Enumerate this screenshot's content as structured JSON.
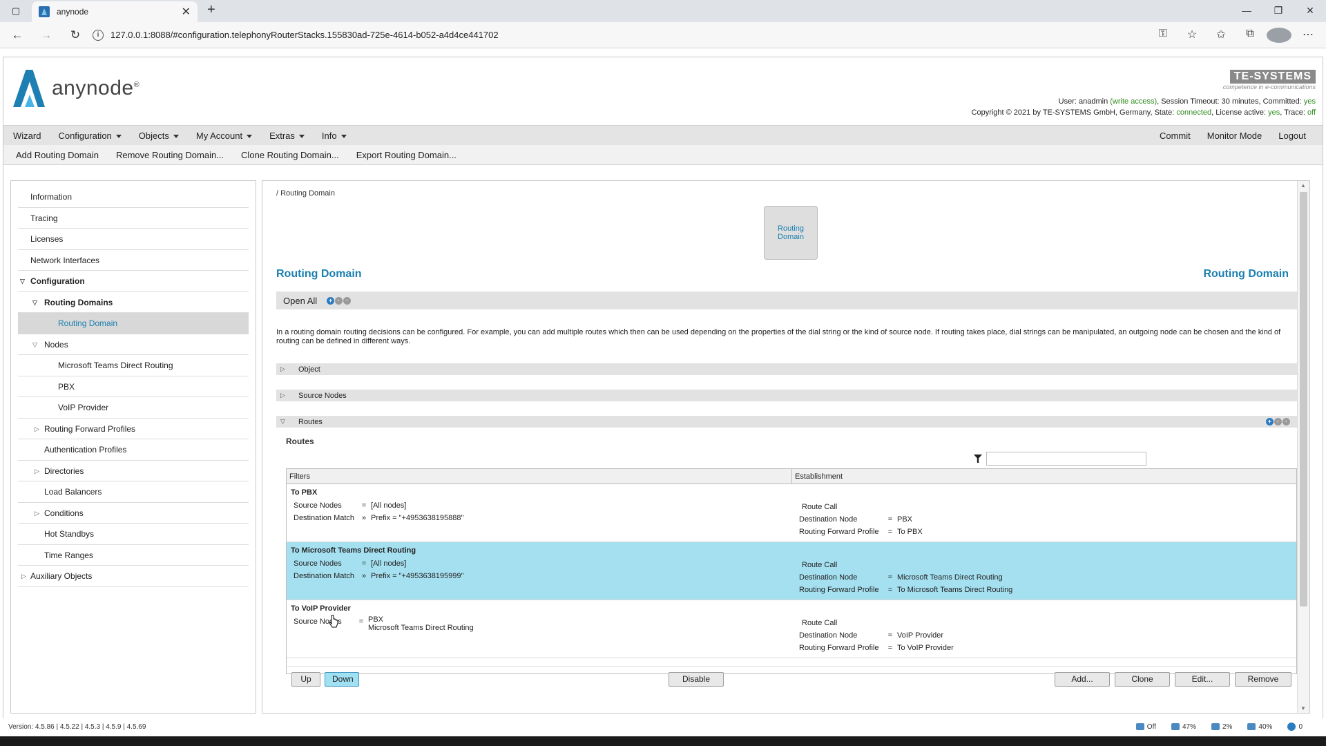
{
  "browser": {
    "tab_title": "anynode",
    "url": "127.0.0.1:8088/#configuration.telephonyRouterStacks.155830ad-725e-4614-b052-a4d4ce441702"
  },
  "header": {
    "brand": "anynode",
    "te_brand": "TE-SYSTEMS",
    "te_tagline": "competence in e-communications",
    "status": {
      "user_label": "User:",
      "user": "anadmin",
      "access": "(write access)",
      "session": ", Session Timeout: 30 minutes, Committed:",
      "committed": "yes",
      "copyright": "Copyright © 2021 by TE-SYSTEMS GmbH, Germany, State:",
      "state": "connected",
      "license_label": ", License active:",
      "license": "yes",
      "trace_label": ", Trace:",
      "trace": "off"
    }
  },
  "menu": {
    "wizard": "Wizard",
    "configuration": "Configuration",
    "objects": "Objects",
    "my_account": "My Account",
    "extras": "Extras",
    "info": "Info",
    "commit": "Commit",
    "monitor_mode": "Monitor Mode",
    "logout": "Logout"
  },
  "actions": {
    "add": "Add Routing Domain",
    "remove": "Remove Routing Domain...",
    "clone": "Clone Routing Domain...",
    "export": "Export Routing Domain..."
  },
  "sidebar": {
    "information": "Information",
    "tracing": "Tracing",
    "licenses": "Licenses",
    "network_interfaces": "Network Interfaces",
    "configuration": "Configuration",
    "routing_domains": "Routing Domains",
    "routing_domain": "Routing Domain",
    "nodes": "Nodes",
    "node_teams": "Microsoft Teams Direct Routing",
    "node_pbx": "PBX",
    "node_voip": "VoIP Provider",
    "routing_forward_profiles": "Routing Forward Profiles",
    "authentication_profiles": "Authentication Profiles",
    "directories": "Directories",
    "load_balancers": "Load Balancers",
    "conditions": "Conditions",
    "hot_standbys": "Hot Standbys",
    "time_ranges": "Time Ranges",
    "auxiliary_objects": "Auxiliary Objects"
  },
  "main": {
    "breadcrumb": "/ Routing Domain",
    "tile": "Routing Domain",
    "title": "Routing Domain",
    "title_right": "Routing Domain",
    "open_all": "Open All",
    "description": "In a routing domain routing decisions can be configured. For example, you can add multiple routes which then can be used depending on the properties of the dial string or the kind of source node. If routing takes place, dial strings can be manipulated, an outgoing node can be chosen and the kind of routing can be defined in different ways.",
    "sections": {
      "object": "Object",
      "source_nodes": "Source Nodes",
      "routes": "Routes"
    },
    "routes_title": "Routes",
    "table": {
      "col_filters": "Filters",
      "col_establishment": "Establishment",
      "rows": [
        {
          "name": "To PBX",
          "source_label": "Source Nodes",
          "source_op": "=",
          "source_value": "[All nodes]",
          "match_label": "Destination Match",
          "match_op": "»",
          "match_value": "Prefix = \"+4953638195888\"",
          "route": "Route Call",
          "dest_label": "Destination Node",
          "dest_op": "=",
          "dest_value": "PBX",
          "rfp_label": "Routing Forward Profile",
          "rfp_op": "=",
          "rfp_value": "To PBX"
        },
        {
          "name": "To Microsoft Teams Direct Routing",
          "source_label": "Source Nodes",
          "source_op": "=",
          "source_value": "[All nodes]",
          "match_label": "Destination Match",
          "match_op": "»",
          "match_value": "Prefix = \"+4953638195999\"",
          "route": "Route Call",
          "dest_label": "Destination Node",
          "dest_op": "=",
          "dest_value": "Microsoft Teams Direct Routing",
          "rfp_label": "Routing Forward Profile",
          "rfp_op": "=",
          "rfp_value": "To Microsoft Teams Direct Routing"
        },
        {
          "name": "To VoIP Provider",
          "source_label": "Source Nodes",
          "source_op": "=",
          "source_value": "PBX",
          "source_value2": "Microsoft Teams Direct Routing",
          "route": "Route Call",
          "dest_label": "Destination Node",
          "dest_op": "=",
          "dest_value": "VoIP Provider",
          "rfp_label": "Routing Forward Profile",
          "rfp_op": "=",
          "rfp_value": "To VoIP Provider"
        }
      ]
    },
    "buttons": {
      "up": "Up",
      "down": "Down",
      "disable": "Disable",
      "add": "Add...",
      "clone": "Clone",
      "edit": "Edit...",
      "remove": "Remove"
    }
  },
  "footer": {
    "version": "Version: 4.5.86 | 4.5.22 | 4.5.3 | 4.5.9 | 4.5.69",
    "off": "Off",
    "cpu": "47%",
    "disk": "2%",
    "mem": "40%",
    "count": "0"
  }
}
